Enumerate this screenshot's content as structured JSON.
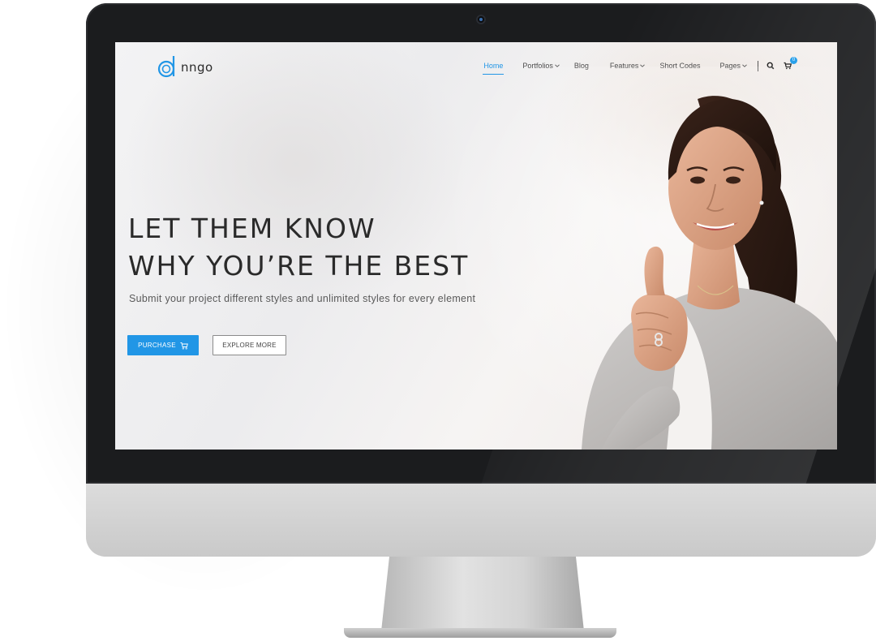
{
  "brand": {
    "logo_text": "nngo",
    "accent_color": "#2196e6"
  },
  "nav": {
    "items": [
      {
        "label": "Home",
        "active": true,
        "dropdown": false
      },
      {
        "label": "Portfolios",
        "active": false,
        "dropdown": true
      },
      {
        "label": "Blog",
        "active": false,
        "dropdown": false
      },
      {
        "label": "Features",
        "active": false,
        "dropdown": true
      },
      {
        "label": "Short Codes",
        "active": false,
        "dropdown": false
      },
      {
        "label": "Pages",
        "active": false,
        "dropdown": true
      }
    ],
    "search_icon": "search-icon",
    "cart_icon": "cart-icon",
    "cart_count": "0"
  },
  "hero": {
    "title_line1": "LET THEM KNOW",
    "title_line2": "WHY YOU’RE THE BEST",
    "subtitle": "Submit your project different styles and unlimited styles for every element",
    "purchase_label": "PURCHASE",
    "explore_label": "EXPLORE MORE"
  },
  "device": {
    "type": "desktop monitor mockup"
  }
}
